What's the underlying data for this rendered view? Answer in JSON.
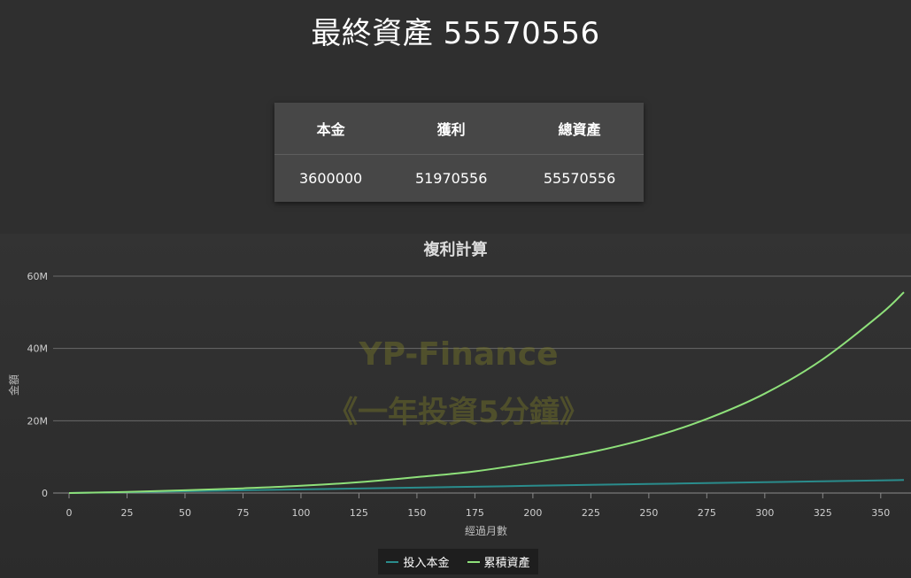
{
  "header": {
    "title": "最終資產 55570556"
  },
  "summary": {
    "headers": [
      "本金",
      "獲利",
      "總資產"
    ],
    "values": [
      "3600000",
      "51970556",
      "55570556"
    ]
  },
  "watermark": {
    "line1": "YP-Finance",
    "line2": "《一年投資5分鐘》"
  },
  "colors": {
    "principal": "#2a8c8c",
    "total": "#8ee07a",
    "grid": "#6a6a6a"
  },
  "chart_data": {
    "type": "line",
    "title": "複利計算",
    "xlabel": "經過月數",
    "ylabel": "金額",
    "xlim": [
      0,
      360
    ],
    "ylim": [
      0,
      60000000
    ],
    "x_ticks": [
      "0",
      "25",
      "50",
      "75",
      "100",
      "125",
      "150",
      "175",
      "200",
      "225",
      "250",
      "275",
      "300",
      "325",
      "350"
    ],
    "y_ticks": [
      "0",
      "20M",
      "40M",
      "60M"
    ],
    "grid": true,
    "legend_position": "bottom",
    "x": [
      0,
      25,
      50,
      75,
      100,
      125,
      150,
      175,
      200,
      225,
      250,
      275,
      300,
      325,
      350,
      360
    ],
    "series": [
      {
        "name": "投入本金",
        "values": [
          0,
          250000,
          500000,
          750000,
          1000000,
          1250000,
          1500000,
          1750000,
          2000000,
          2250000,
          2500000,
          2750000,
          3000000,
          3250000,
          3500000,
          3600000
        ]
      },
      {
        "name": "累積資產",
        "values": [
          0,
          300000,
          750000,
          1300000,
          2000000,
          3000000,
          4400000,
          6000000,
          8400000,
          11300000,
          15200000,
          20500000,
          27500000,
          37000000,
          49500000,
          55570556
        ]
      }
    ]
  }
}
